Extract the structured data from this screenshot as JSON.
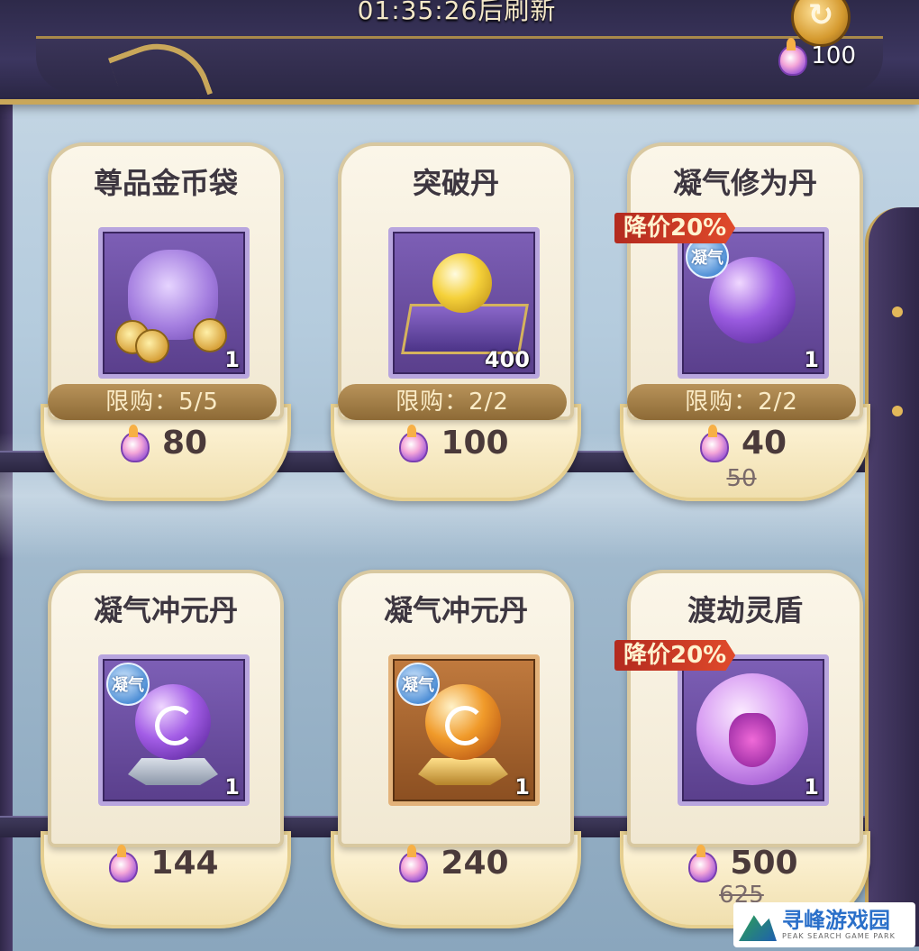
{
  "header": {
    "refresh_text": "01:35:26后刷新",
    "currency_amount": "100"
  },
  "cards": [
    {
      "name": "尊品金币袋",
      "quantity": "1",
      "limit": "限购：5/5",
      "price": "80",
      "old_price": null,
      "discount": null,
      "element_badge": null,
      "icon": "coin-bag-icon"
    },
    {
      "name": "突破丹",
      "quantity": "400",
      "limit": "限购：2/2",
      "price": "100",
      "old_price": null,
      "discount": null,
      "element_badge": null,
      "icon": "golden-pill-icon"
    },
    {
      "name": "凝气修为丹",
      "quantity": "1",
      "limit": "限购：2/2",
      "price": "40",
      "old_price": "50",
      "discount": "降价20%",
      "element_badge": "凝气",
      "icon": "purple-orb-icon"
    },
    {
      "name": "凝气冲元丹",
      "quantity": "1",
      "limit": null,
      "price": "144",
      "old_price": null,
      "discount": null,
      "element_badge": "凝气",
      "icon": "purple-spiral-orb-icon"
    },
    {
      "name": "凝气冲元丹",
      "quantity": "1",
      "limit": null,
      "price": "240",
      "old_price": null,
      "discount": null,
      "element_badge": "凝气",
      "icon": "orange-spiral-orb-icon"
    },
    {
      "name": "渡劫灵盾",
      "quantity": "1",
      "limit": null,
      "price": "500",
      "old_price": "625",
      "discount": "降价20%",
      "element_badge": null,
      "icon": "spirit-shield-icon"
    }
  ],
  "watermark": {
    "main": "寻峰游戏园",
    "sub": "PEAK SEARCH GAME PARK"
  },
  "colors": {
    "panel": "#fbf6e9",
    "item_purple": "#7d5fb6",
    "item_orange": "#c07a3e",
    "discount_red": "#d03a25",
    "limit_bar": "#a8824a"
  }
}
